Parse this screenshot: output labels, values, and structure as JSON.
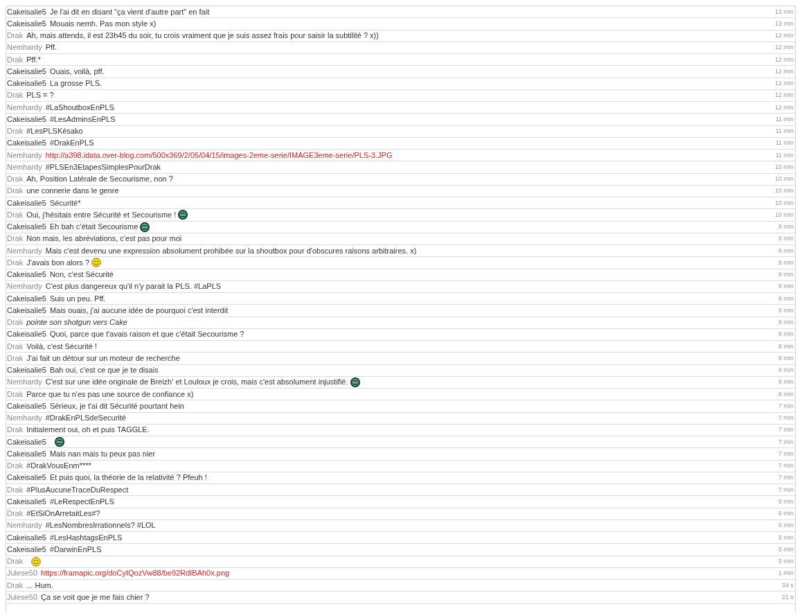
{
  "messages": [
    {
      "author": "Cakeisalie5",
      "color": "#333333",
      "text": "Je l'ai dit en disant \"ça vient d'autre part\" en fait",
      "time": "13 min"
    },
    {
      "author": "Cakeisalie5",
      "color": "#333333",
      "text": "Mouais nemh. Pas mon style x)",
      "time": "13 min"
    },
    {
      "author": "Drak",
      "color": "#888888",
      "text": "Ah, mais attends, il est 23h45 du soir, tu crois vraiment que je suis assez frais pour saisir la subtilité ? x))",
      "time": "12 min"
    },
    {
      "author": "Nemhardy",
      "color": "#888888",
      "text": "Pff.",
      "time": "12 min"
    },
    {
      "author": "Drak",
      "color": "#888888",
      "text": "Pff.*",
      "time": "12 min"
    },
    {
      "author": "Cakeisalie5",
      "color": "#333333",
      "text": "Ouais, voilà, pff.",
      "time": "12 min"
    },
    {
      "author": "Cakeisalie5",
      "color": "#333333",
      "text": "La grosse PLS.",
      "time": "12 min"
    },
    {
      "author": "Drak",
      "color": "#888888",
      "text": "PLS = ?",
      "time": "12 min"
    },
    {
      "author": "Nemhardy",
      "color": "#888888",
      "text": "#LaShoutboxEnPLS",
      "time": "12 min"
    },
    {
      "author": "Cakeisalie5",
      "color": "#333333",
      "text": "#LesAdminsEnPLS",
      "time": "11 min"
    },
    {
      "author": "Drak",
      "color": "#888888",
      "text": "#LesPLSKésako",
      "time": "11 min"
    },
    {
      "author": "Cakeisalie5",
      "color": "#333333",
      "text": "#DrakEnPLS",
      "time": "11 min"
    },
    {
      "author": "Nemhardy",
      "color": "#888888",
      "kind": "link",
      "text": "http://a398.idata.over-blog.com/500x369/2/05/04/15/images-2eme-serie/IMAGE3eme-serie/PLS-3.JPG",
      "time": "11 min"
    },
    {
      "author": "Nemhardy",
      "color": "#888888",
      "text": "#PLSEn3EtapesSimplesPourDrak",
      "time": "10 min"
    },
    {
      "author": "Drak",
      "color": "#888888",
      "text": "Ah, Position Latérale de Secourisme, non ?",
      "time": "10 min"
    },
    {
      "author": "Drak",
      "color": "#888888",
      "text": "une connerie dans le genre",
      "time": "10 min"
    },
    {
      "author": "Cakeisalie5",
      "color": "#333333",
      "text": "Sécurité*",
      "time": "10 min"
    },
    {
      "author": "Drak",
      "color": "#888888",
      "text": "Oui, j'hésitais entre Sécurité et Secourisme !",
      "smiley": {
        "kind": "grin"
      },
      "time": "10 min"
    },
    {
      "author": "Cakeisalie5",
      "color": "#333333",
      "text": "Eh bah c'était Secourisme",
      "smiley": {
        "kind": "grin"
      },
      "time": "9 min"
    },
    {
      "author": "Drak",
      "color": "#888888",
      "text": "Non mais, les abréviations, c'est pas pour moi",
      "time": "9 min"
    },
    {
      "author": "Nemhardy",
      "color": "#888888",
      "text": "Mais c'est devenu une expression absolument prohibée sur la shoutbox pour d'obscures raisons arbitraires. x)",
      "time": "9 min"
    },
    {
      "author": "Drak",
      "color": "#888888",
      "text": "J'avais bon alors ?",
      "smiley": {
        "kind": "smile"
      },
      "time": "9 min"
    },
    {
      "author": "Cakeisalie5",
      "color": "#333333",
      "text": "Non, c'est Sécurité",
      "time": "9 min"
    },
    {
      "author": "Nemhardy",
      "color": "#888888",
      "text": "C'est plus dangereux qu'il n'y parait la PLS. #LaPLS",
      "time": "9 min"
    },
    {
      "author": "Cakeisalie5",
      "color": "#333333",
      "text": "Suis un peu. Pff.",
      "time": "9 min"
    },
    {
      "author": "Cakeisalie5",
      "color": "#333333",
      "text": "Mais ouais, j'ai aucune idée de pourquoi c'est interdit",
      "time": "9 min"
    },
    {
      "author": "Drak",
      "color": "#888888",
      "kind": "action",
      "text": "pointe son shotgun vers Cake",
      "time": "8 min"
    },
    {
      "author": "Cakeisalie5",
      "color": "#333333",
      "text": "Quoi, parce que t'avais raison et que c'était Secourisme ?",
      "time": "8 min"
    },
    {
      "author": "Drak",
      "color": "#888888",
      "text": "Voilà, c'est Sécurité !",
      "time": "8 min"
    },
    {
      "author": "Drak",
      "color": "#888888",
      "text": "J'ai fait un détour sur un moteur de recherche",
      "time": "8 min"
    },
    {
      "author": "Cakeisalie5",
      "color": "#333333",
      "text": "Bah oui, c'est ce que je te disais",
      "time": "8 min"
    },
    {
      "author": "Nemhardy",
      "color": "#888888",
      "text": "C'est sur une idée originale de Breizh' et Louloux je crois, mais c'est absolument injustifié.",
      "smiley": {
        "kind": "grin"
      },
      "time": "8 min"
    },
    {
      "author": "Drak",
      "color": "#888888",
      "text": "Parce que tu n'es pas une source de confiance x)",
      "time": "8 min"
    },
    {
      "author": "Cakeisalie5",
      "color": "#333333",
      "text": "Sérieux, je t'ai dit Sécurité pourtant hein",
      "time": "7 min"
    },
    {
      "author": "Nemhardy",
      "color": "#888888",
      "text": "#DrakEnPLSdeSecurité",
      "time": "7 min"
    },
    {
      "author": "Drak",
      "color": "#888888",
      "text": "Initialement oui, oh et puis TAGGLE.",
      "time": "7 min"
    },
    {
      "author": "Cakeisalie5",
      "color": "#333333",
      "smiley": {
        "kind": "grin"
      },
      "time": "7 min"
    },
    {
      "author": "Cakeisalie5",
      "color": "#333333",
      "text": "Mais nan mais tu peux pas nier",
      "time": "7 min"
    },
    {
      "author": "Drak",
      "color": "#888888",
      "text": "#DrakVousEnm****",
      "time": "7 min"
    },
    {
      "author": "Cakeisalie5",
      "color": "#333333",
      "text": "Et puis quoi, la théorie de la relativité ? Pfeuh !",
      "time": "7 min"
    },
    {
      "author": "Drak",
      "color": "#888888",
      "text": "#PlusAucuneTraceDuRespect",
      "time": "7 min"
    },
    {
      "author": "Cakeisalie5",
      "color": "#333333",
      "text": "#LeRespectEnPLS",
      "time": "6 min"
    },
    {
      "author": "Drak",
      "color": "#888888",
      "text": "#EtSiOnArretaitLes#?",
      "time": "6 min"
    },
    {
      "author": "Nemhardy",
      "color": "#888888",
      "text": "#LesNombresIrrationnels? #LOL",
      "time": "6 min"
    },
    {
      "author": "Cakeisalie5",
      "color": "#333333",
      "text": "#LesHashtagsEnPLS",
      "time": "6 min"
    },
    {
      "author": "Cakeisalie5",
      "color": "#333333",
      "text": "#DarwinEnPLS",
      "time": "5 min"
    },
    {
      "author": "Drak",
      "color": "#888888",
      "smiley": {
        "kind": "smile"
      },
      "time": "5 min"
    },
    {
      "author": "Julese50",
      "color": "#888888",
      "kind": "link",
      "text": "https://framapic.org/doCyIQozVw88/be92RdIBAh0x.png",
      "time": "1 min"
    },
    {
      "author": "Drak",
      "color": "#888888",
      "text": "... Hum.",
      "time": "34 s"
    },
    {
      "author": "Julese50",
      "color": "#888888",
      "text": "Ça se voit que je me fais chier ?",
      "time": "21 s"
    }
  ]
}
